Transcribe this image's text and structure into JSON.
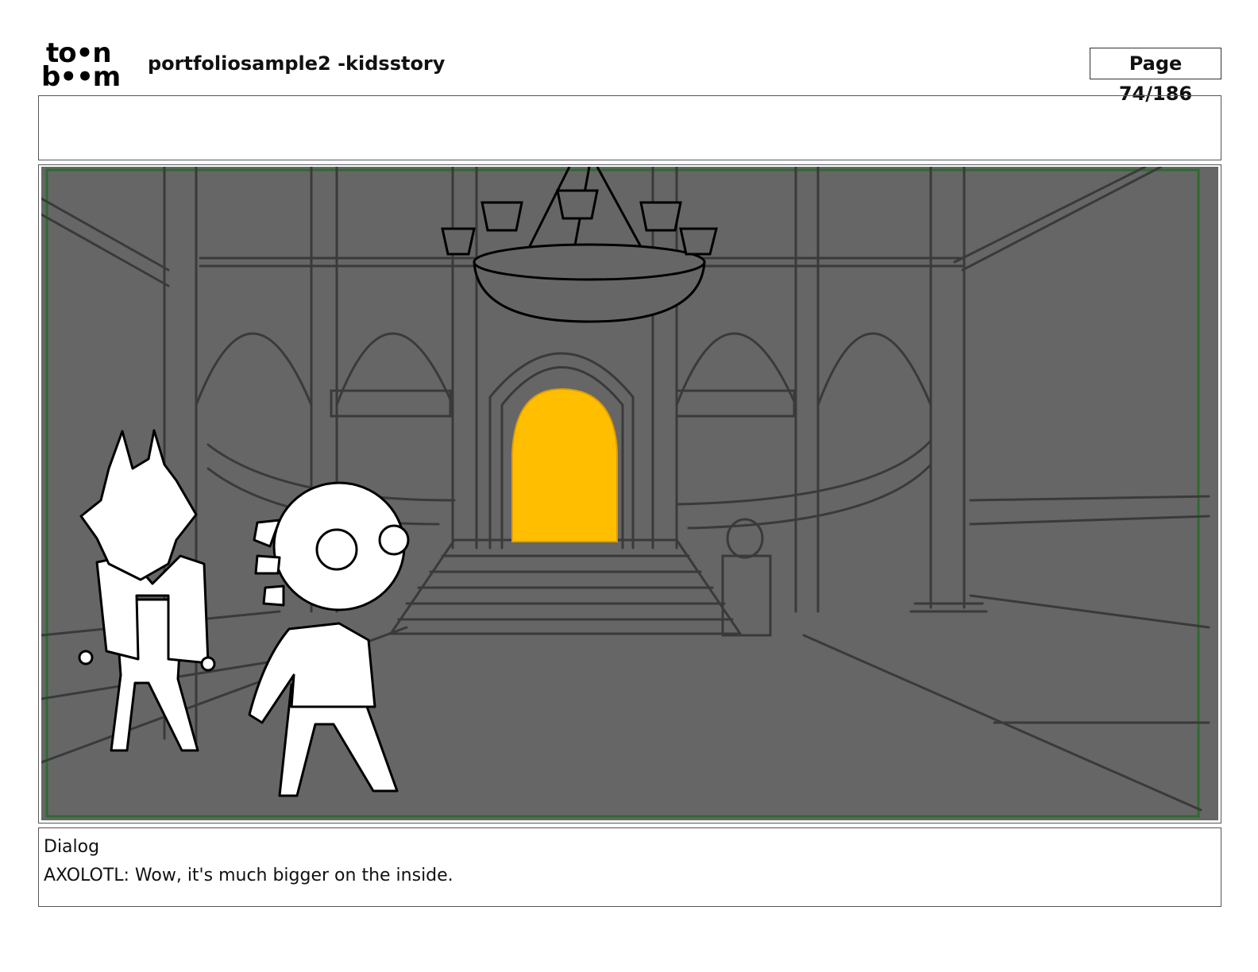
{
  "logo": {
    "line1": "to•n",
    "line2": "b••m"
  },
  "header": {
    "title": "portfoliosample2 -kidsstory",
    "page_label": "Page",
    "page_value": "74/186"
  },
  "notes": "",
  "panel": {
    "frame_color": "#2e6b2e",
    "background_color": "#666666",
    "doorway_color": "#ffbf00"
  },
  "dialog": {
    "heading": "Dialog",
    "text": "AXOLOTL: Wow, it's much bigger on the inside."
  }
}
